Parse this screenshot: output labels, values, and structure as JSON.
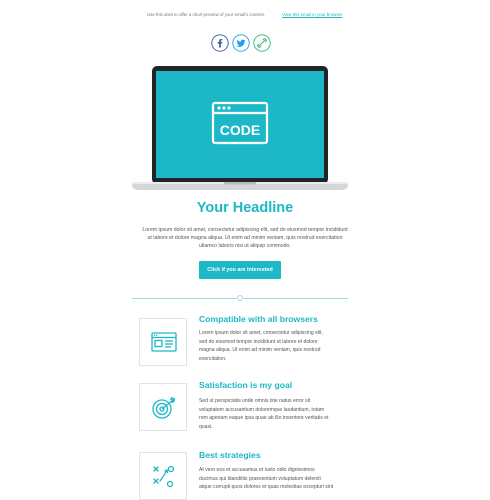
{
  "preheader": {
    "text": "Use this area to offer a short preview of your email's content.",
    "link_label": "View this email in your browser"
  },
  "social": [
    {
      "name": "facebook-icon",
      "glyph": "f"
    },
    {
      "name": "twitter-icon",
      "glyph": "bird"
    },
    {
      "name": "link-icon",
      "glyph": "link"
    }
  ],
  "hero": {
    "screen_text": "CODE",
    "screen_color": "#1cb8c8"
  },
  "headline": "Your Headline",
  "intro": {
    "line1": "Lorem ipsum dolor sit amet, consectetur adipiscing elit, sed do eiusmod tempor incididunt",
    "line2": "ut labore et dolore magna aliqua. Ut enim ad minim veniam, quis nostrud exercitation",
    "line3": "ullamco laboris nisi ut aliquip commodo."
  },
  "cta_label": "Click if you are interested",
  "features": [
    {
      "icon": "browser-window-icon",
      "title": "Compatible with all browsers",
      "lines": [
        "Lorem ipsum dolor sit amet, consectetur adipiscing elit,",
        "sed do eiusmod tempor incididunt ut labore et dolore",
        "magna aliqua. Ut enim ad minim veniam, quis nostrud",
        "exercitation."
      ]
    },
    {
      "icon": "target-icon",
      "title": "Satisfaction is my goal",
      "lines": [
        "Sed ut perspiciatis unde omnis iste natus error sit",
        "voluptatem accusantium doloremque laudantium, totam",
        "rem aperiam eaque ipsa quae ab illo inventore veritatis et",
        "quasi."
      ]
    },
    {
      "icon": "strategy-icon",
      "title": "Best strategies",
      "lines": [
        "At vero eos et accusamus et iusto odio dignissimos",
        "ducimus qui blanditiis praesentium voluptatum deleniti",
        "atque corrupti quos dolores et quas molestias excepturi sint"
      ]
    }
  ],
  "colors": {
    "accent": "#1cb8c8",
    "text": "#555555",
    "divider": "#9fd9e2"
  }
}
